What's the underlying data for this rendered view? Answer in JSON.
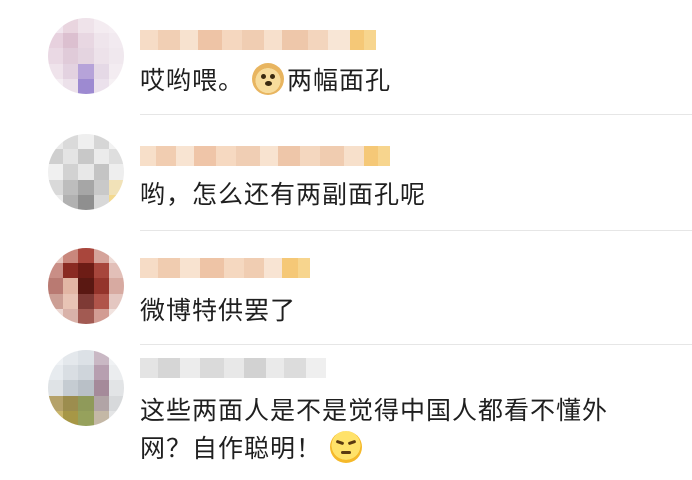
{
  "comments": [
    {
      "id": "comment-1",
      "username": "",
      "text": "哎哟喂。",
      "emoji": "doge-emoji",
      "text_after": "两幅面孔"
    },
    {
      "id": "comment-2",
      "username": "",
      "text": "哟，怎么还有两副面孔呢",
      "emoji": "",
      "text_after": ""
    },
    {
      "id": "comment-3",
      "username": "",
      "text": "微博特供罢了",
      "emoji": "",
      "text_after": ""
    },
    {
      "id": "comment-4",
      "username": "",
      "text": "这些两面人是不是觉得中国人都看不懂外",
      "text_line2": "网？自作聪明！",
      "emoji": "smug-face-emoji",
      "text_after": ""
    }
  ],
  "colors": {
    "text": "#1f1f1f",
    "divider": "#e6e6e6",
    "username_blur": "#f3c9a8",
    "badge": "#f7c96a"
  }
}
